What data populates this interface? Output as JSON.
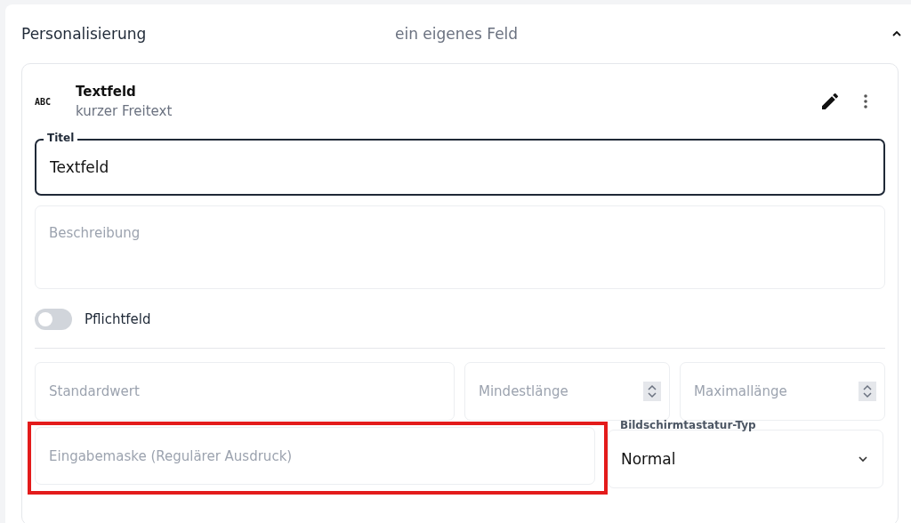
{
  "section": {
    "title": "Personalisierung",
    "subtitle": "ein eigenes Feld",
    "expanded": true
  },
  "field_card": {
    "icon_text": "ABC",
    "name": "Textfeld",
    "description": "kurzer Freitext"
  },
  "title_field": {
    "label": "Titel",
    "value": "Textfeld",
    "focused": true
  },
  "description_field": {
    "placeholder": "Beschreibung"
  },
  "required_toggle": {
    "label": "Pflichtfeld",
    "on": false
  },
  "default_field": {
    "placeholder": "Standardwert"
  },
  "number_fields": [
    {
      "placeholder": "Mindestlänge"
    },
    {
      "placeholder": "Maximallänge"
    }
  ],
  "mask_field": {
    "placeholder": "Eingabemaske (Regulärer Ausdruck)",
    "highlighted": true
  },
  "keyboard_select": {
    "label": "Bildschirmtastatur-Typ",
    "value": "Normal"
  }
}
